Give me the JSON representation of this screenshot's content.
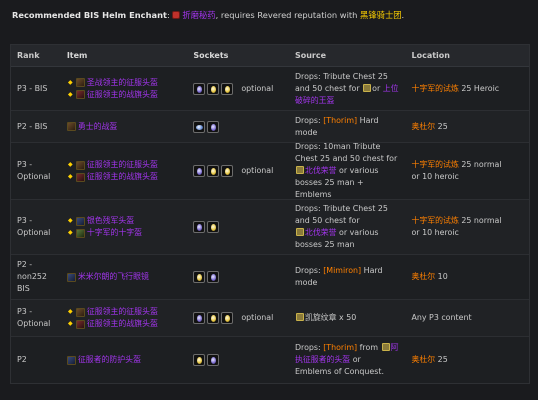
{
  "intro": {
    "bold": "Recommended BIS Helm Enchant",
    "colon": ": ",
    "enchant": "折磨秘药",
    "mid": ", requires Revered reputation with ",
    "faction": "黑锋骑士团",
    "end": "."
  },
  "headers": [
    "Rank",
    "Item",
    "Sockets",
    "Source",
    "Location"
  ],
  "rows": [
    {
      "rank": "P3 - BIS",
      "items": [
        "圣战领主的征服头盔",
        "征服领主的战旗头盔"
      ],
      "sockets": [
        "meta",
        "yellow",
        "yellow"
      ],
      "optional": "optional",
      "source": [
        "Drops: Tribute Chest 25",
        "and 50 chest for",
        "or",
        "上位",
        "破碎的王盔"
      ],
      "location": [
        "十字军的试炼",
        " 25 Heroic"
      ]
    },
    {
      "rank": "P2 - BIS",
      "items": [
        "勇士的战盔"
      ],
      "sockets": [
        "blue",
        "meta"
      ],
      "optional": "",
      "source": [
        "Drops: ",
        "[Thorim]",
        " Hard",
        "mode"
      ],
      "location": [
        "奥杜尔",
        " 25"
      ]
    },
    {
      "rank": "P3 - Optional",
      "items": [
        "征服领主的征服头盔",
        "征服领主的战旗头盔"
      ],
      "sockets": [
        "meta",
        "yellow",
        "yellow"
      ],
      "optional": "optional",
      "source": [
        "Drops: 10man Tribute",
        "Chest 25 and 50 chest for",
        "北伐荣誉",
        " or various",
        "bosses 25 man + Emblems"
      ],
      "location": [
        "十字军的试炼",
        " 25 normal",
        "or 10 heroic"
      ]
    },
    {
      "rank": "P3 - Optional",
      "items": [
        "银色残军头盔",
        "十字军的十字盔"
      ],
      "sockets": [
        "meta",
        "yellow"
      ],
      "optional": "",
      "source": [
        "Drops: Tribute Chest 25",
        "and 50 chest for",
        "北伐荣誉",
        " or various",
        "bosses 25 man"
      ],
      "location": [
        "十字军的试炼",
        " 25 normal",
        "or 10 heroic"
      ]
    },
    {
      "rank": "P2 - non252 BIS",
      "items": [
        "米米尔朗的飞行眼镜"
      ],
      "sockets": [
        "yellow",
        "meta"
      ],
      "optional": "",
      "source": [
        "Drops: ",
        "[Mimiron]",
        " Hard",
        "mode"
      ],
      "location": [
        "奥杜尔",
        " 10"
      ]
    },
    {
      "rank": "P3 - Optional",
      "items": [
        "征服领主的征服头盔",
        "征服领主的战旗头盔"
      ],
      "sockets": [
        "meta",
        "yellow",
        "yellow"
      ],
      "optional": "optional",
      "source": [
        "凯旋纹章",
        " x 50"
      ],
      "location": [
        "Any P3 content"
      ]
    },
    {
      "rank": "P2",
      "items": [
        "征服者的防护头盔"
      ],
      "sockets": [
        "yellow",
        "meta"
      ],
      "optional": "",
      "source": [
        "Drops: ",
        "[Thorim]",
        " from ",
        "阿",
        "执征服者的头盔",
        " or",
        "Emblems of Conquest."
      ],
      "location": [
        "奥杜尔",
        " 25"
      ]
    }
  ],
  "colors": {
    "epic": "#a335ee",
    "quest": "#ffd100",
    "legendary": "#ff8000",
    "background": "#1a1b1e"
  }
}
